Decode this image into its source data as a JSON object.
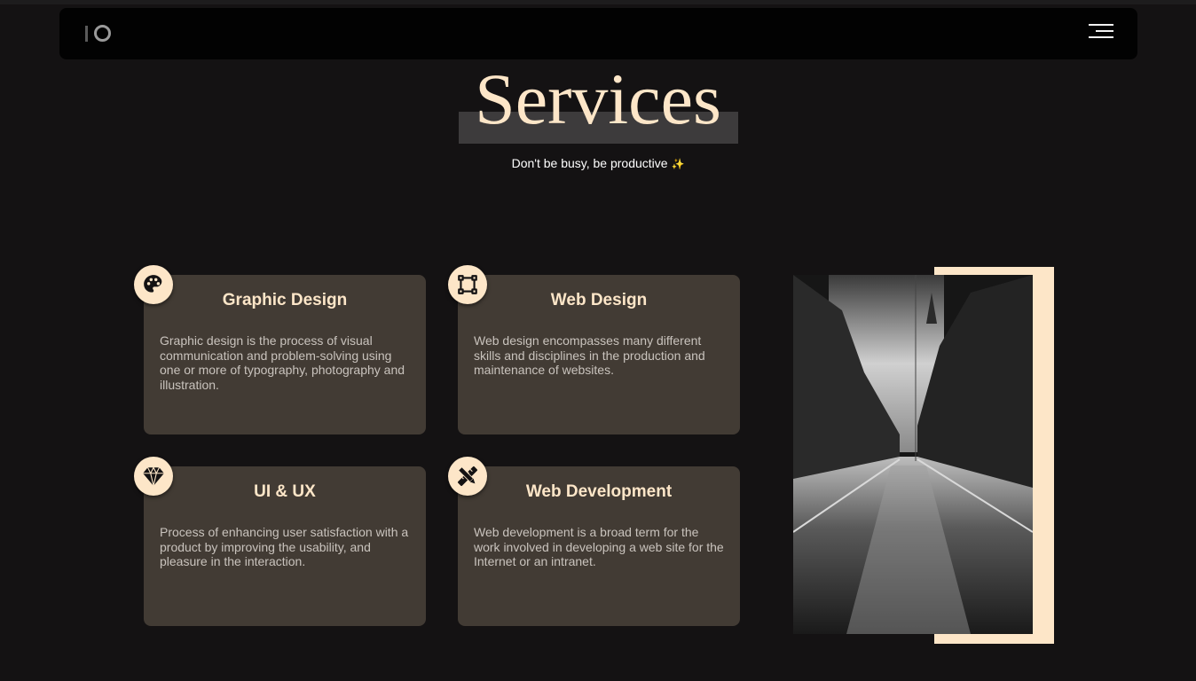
{
  "nav": {
    "logo_icon": "io-logo-icon",
    "menu_icon": "hamburger-menu-icon"
  },
  "header": {
    "title": "Services",
    "subtitle": "Don't be busy, be productive",
    "subtitle_emoji": "✨"
  },
  "services": [
    {
      "icon": "palette-icon",
      "title": "Graphic Design",
      "description": "Graphic design is the process of visual communication and problem-solving using one or more of typography, photography and illustration."
    },
    {
      "icon": "vector-square-icon",
      "title": "Web Design",
      "description": "Web design encompasses many different skills and disciplines in the production and maintenance of websites."
    },
    {
      "icon": "diamond-icon",
      "title": "UI & UX",
      "description": "Process of enhancing user satisfaction with a product by improving the usability, and pleasure in the interaction."
    },
    {
      "icon": "pencil-ruler-icon",
      "title": "Web Development",
      "description": "Web development is a broad term for the work involved in developing a web site for the Internet or an intranet."
    }
  ],
  "colors": {
    "background": "#141213",
    "accent": "#fde6c8",
    "card": "#423b34",
    "navbar": "#020202"
  }
}
